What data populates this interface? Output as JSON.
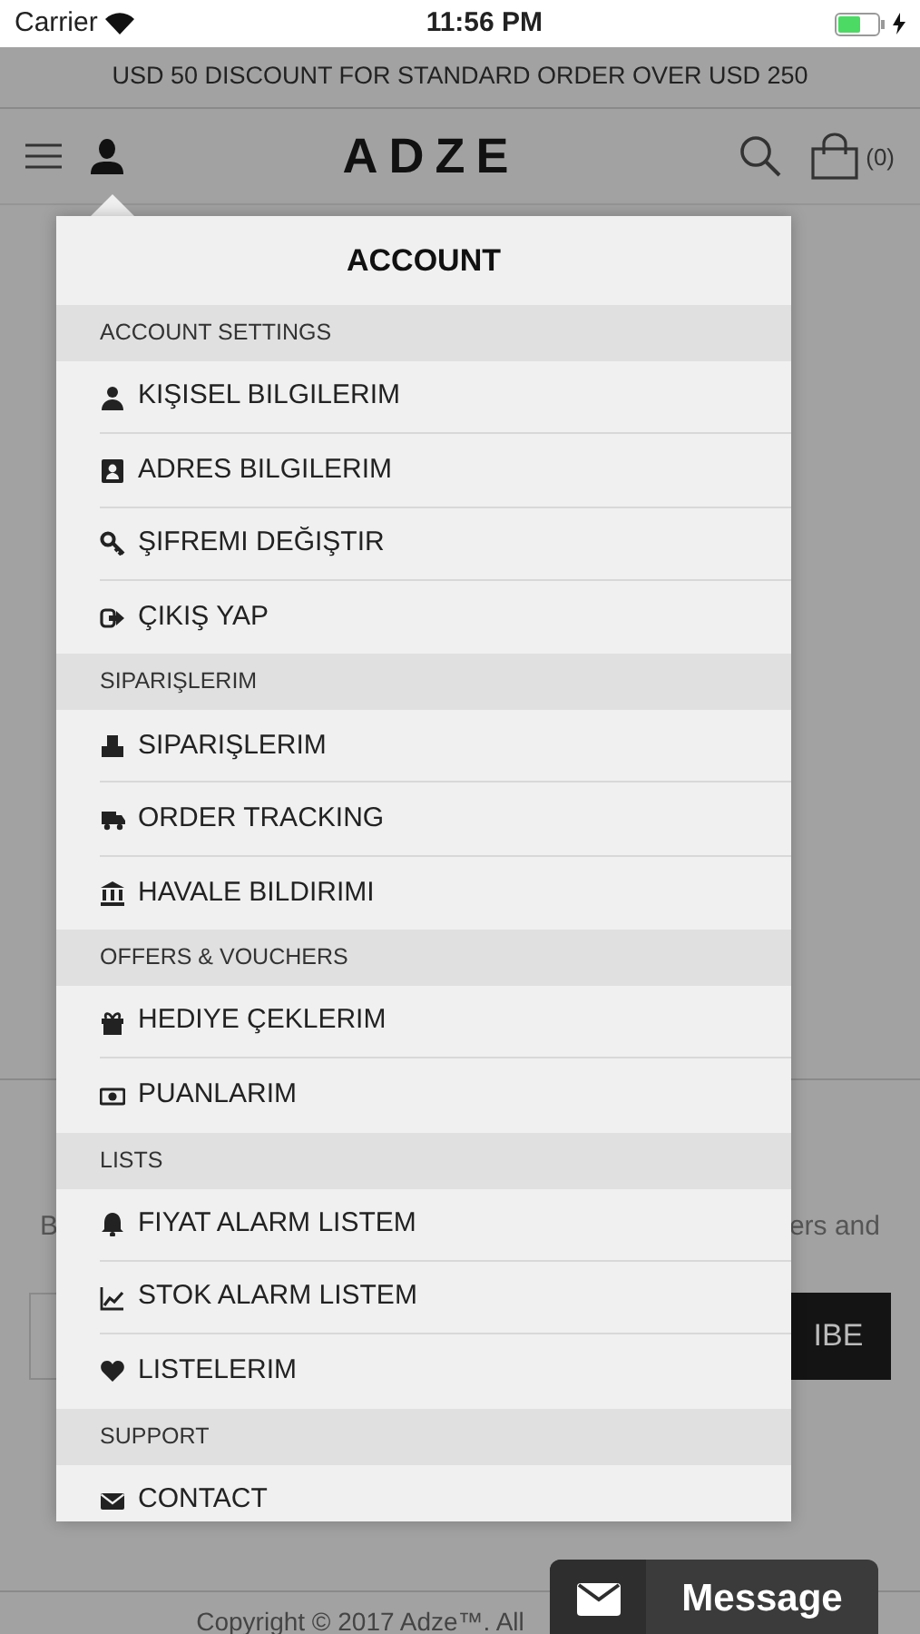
{
  "status_bar": {
    "carrier": "Carrier",
    "time": "11:56 PM"
  },
  "promo_banner": "USD 50 DISCOUNT FOR STANDARD ORDER OVER USD 250",
  "header": {
    "logo": "ADZE",
    "cart_count": "(0)"
  },
  "background": {
    "newsletter_left": "B",
    "newsletter_right": "ers and",
    "subscribe_button": "IBE",
    "footer": "Copyright © 2017 Adze™. All"
  },
  "account_menu": {
    "title": "ACCOUNT",
    "sections": [
      {
        "heading": "ACCOUNT SETTINGS",
        "items": [
          "KIŞISEL BILGILERIM",
          "ADRES BILGILERIM",
          "ŞIFREMI DEĞIŞTIR",
          "ÇIKIŞ YAP"
        ]
      },
      {
        "heading": "SIPARIŞLERIM",
        "items": [
          "SIPARIŞLERIM",
          "ORDER TRACKING",
          "HAVALE BILDIRIMI"
        ]
      },
      {
        "heading": "OFFERS & VOUCHERS",
        "items": [
          "HEDIYE ÇEKLERIM",
          "PUANLARIM"
        ]
      },
      {
        "heading": "LISTS",
        "items": [
          "FIYAT ALARM LISTEM",
          "STOK ALARM LISTEM",
          "LISTELERIM"
        ]
      },
      {
        "heading": "SUPPORT",
        "items": [
          "CONTACT"
        ]
      }
    ]
  },
  "message_button": "Message"
}
